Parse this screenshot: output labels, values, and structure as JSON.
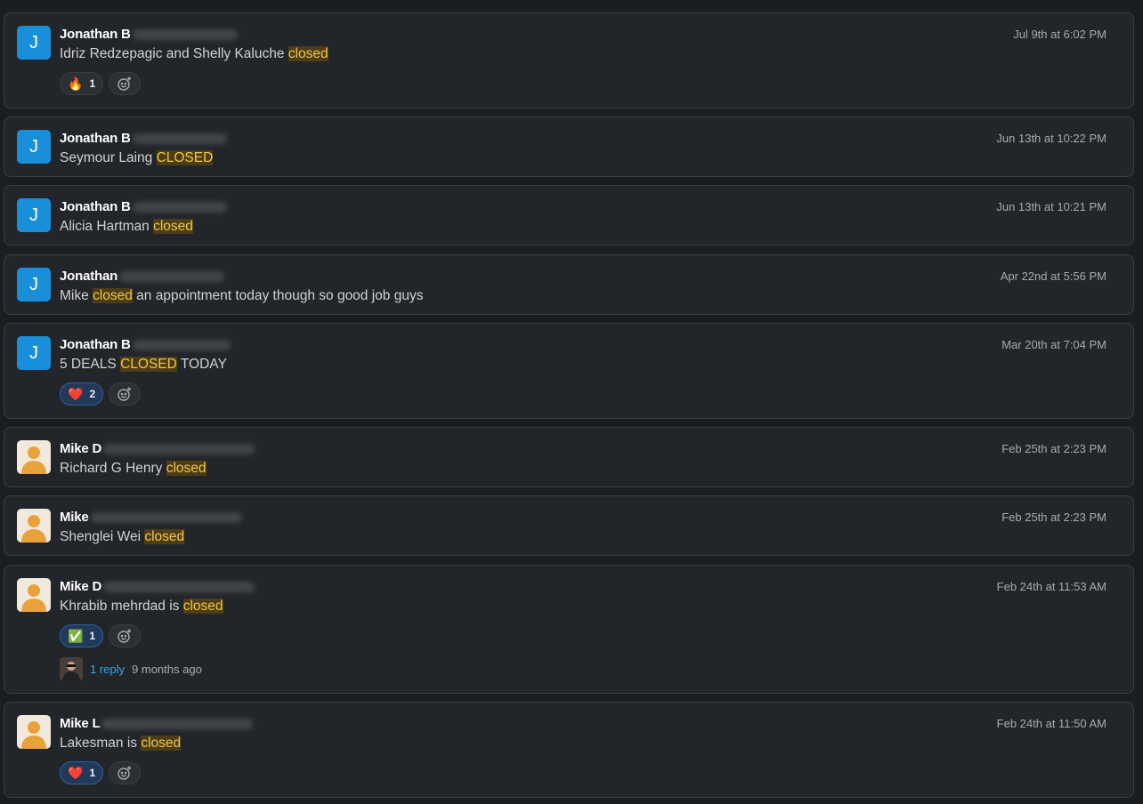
{
  "messages": [
    {
      "avatar": "J",
      "avatar_type": "letter",
      "name": "Jonathan B",
      "time": "Jul 9th at 6:02 PM",
      "pre": "Idriz Redzepagic and Shelly Kaluche ",
      "hl": "closed",
      "post": "",
      "reaction": {
        "emoji": "🔥",
        "count": "1"
      }
    },
    {
      "avatar": "J",
      "avatar_type": "letter",
      "name": "Jonathan B",
      "time": "Jun 13th at 10:22 PM",
      "pre": "Seymour Laing ",
      "hl": "CLOSED",
      "post": ""
    },
    {
      "avatar": "J",
      "avatar_type": "letter",
      "name": "Jonathan B",
      "time": "Jun 13th at 10:21 PM",
      "pre": "Alicia Hartman ",
      "hl": "closed",
      "post": ""
    },
    {
      "avatar": "J",
      "avatar_type": "letter",
      "name": "Jonathan",
      "time": "Apr 22nd at 5:56 PM",
      "pre": "Mike ",
      "hl": "closed",
      "post": " an appointment today though so good job guys"
    },
    {
      "avatar": "J",
      "avatar_type": "letter",
      "name": "Jonathan B",
      "time": "Mar 20th at 7:04 PM",
      "pre": "5 DEALS ",
      "hl": "CLOSED",
      "post": " TODAY",
      "reaction": {
        "emoji": "❤️",
        "count": "2"
      }
    },
    {
      "avatar": "",
      "avatar_type": "person",
      "name": "Mike D",
      "time": "Feb 25th at 2:23 PM",
      "pre": "Richard G Henry ",
      "hl": "closed",
      "post": ""
    },
    {
      "avatar": "",
      "avatar_type": "person",
      "name": "Mike",
      "time": "Feb 25th at 2:23 PM",
      "pre": "Shenglei Wei ",
      "hl": "closed",
      "post": ""
    },
    {
      "avatar": "",
      "avatar_type": "person",
      "name": "Mike D",
      "time": "Feb 24th at 11:53 AM",
      "pre": "Khrabib mehrdad is ",
      "hl": "closed",
      "post": "",
      "reaction": {
        "emoji": "✅",
        "count": "1"
      },
      "thread": {
        "replies": "1 reply",
        "ago": "9 months ago"
      }
    },
    {
      "avatar": "",
      "avatar_type": "person",
      "name": "Mike L",
      "time": "Feb 24th at 11:50 AM",
      "pre": "Lakesman is ",
      "hl": "closed",
      "post": "",
      "reaction": {
        "emoji": "❤️",
        "count": "1"
      }
    }
  ],
  "colors": {
    "highlight_text": "#f2c744",
    "link": "#36a6e8",
    "avatar_blue": "#1a8fd9"
  },
  "icons": {
    "add_reaction": "add-reaction-icon",
    "person_avatar": "person-avatar-icon"
  }
}
